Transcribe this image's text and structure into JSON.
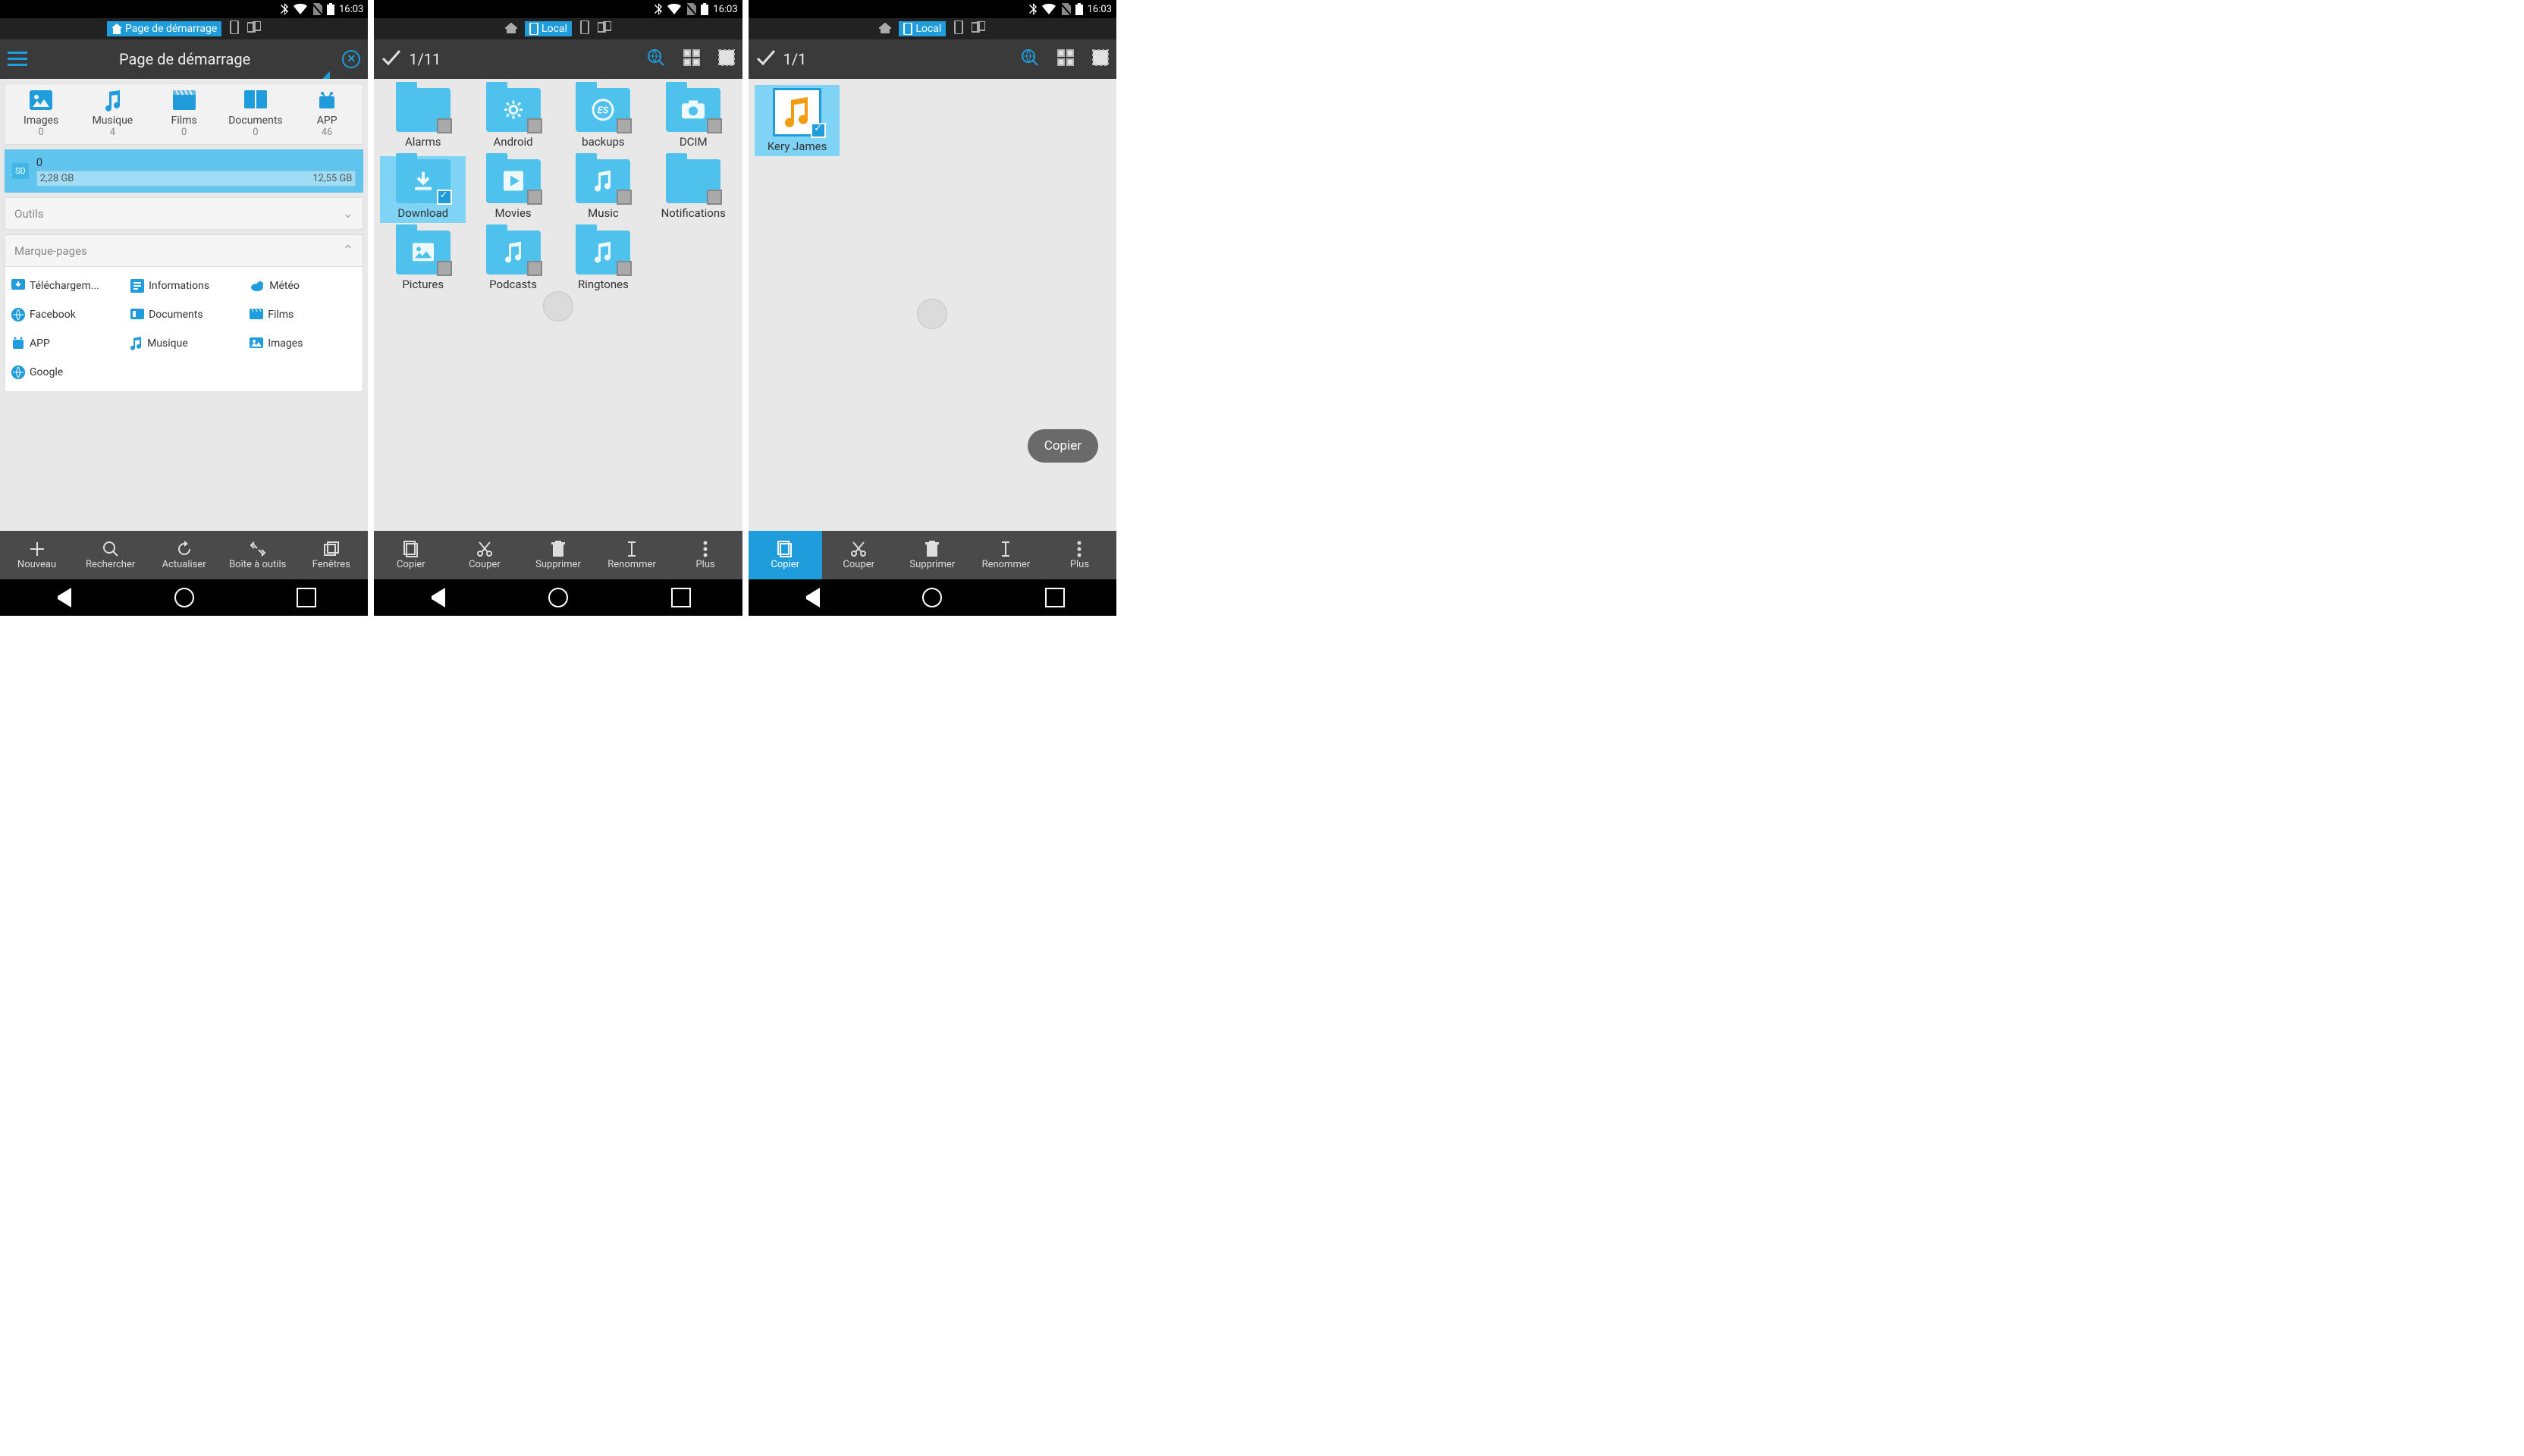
{
  "status": {
    "time": "16:03"
  },
  "screen1": {
    "tab_label": "Page de démarrage",
    "title": "Page de démarrage",
    "categories": [
      {
        "label": "Images",
        "count": "0"
      },
      {
        "label": "Musique",
        "count": "4"
      },
      {
        "label": "Films",
        "count": "0"
      },
      {
        "label": "Documents",
        "count": "0"
      },
      {
        "label": "APP",
        "count": "46"
      }
    ],
    "storage": {
      "name": "0",
      "used": "2,28 GB",
      "total": "12,55 GB"
    },
    "tools_label": "Outils",
    "bookmarks_label": "Marque-pages",
    "bookmarks": [
      {
        "label": "Téléchargem..."
      },
      {
        "label": "Informations"
      },
      {
        "label": "Météo"
      },
      {
        "label": "Facebook"
      },
      {
        "label": "Documents"
      },
      {
        "label": "Films"
      },
      {
        "label": "APP"
      },
      {
        "label": "Musique"
      },
      {
        "label": "Images"
      },
      {
        "label": "Google"
      }
    ],
    "bottom": [
      {
        "label": "Nouveau"
      },
      {
        "label": "Rechercher"
      },
      {
        "label": "Actualiser"
      },
      {
        "label": "Boîte à outils"
      },
      {
        "label": "Fenêtres"
      }
    ]
  },
  "screen2": {
    "tab_label": "Local",
    "count": "1/11",
    "folders": [
      {
        "label": "Alarms",
        "selected": false,
        "icon": "none"
      },
      {
        "label": "Android",
        "selected": false,
        "icon": "gear"
      },
      {
        "label": "backups",
        "selected": false,
        "icon": "es"
      },
      {
        "label": "DCIM",
        "selected": false,
        "icon": "camera"
      },
      {
        "label": "Download",
        "selected": true,
        "icon": "download"
      },
      {
        "label": "Movies",
        "selected": false,
        "icon": "play"
      },
      {
        "label": "Music",
        "selected": false,
        "icon": "music"
      },
      {
        "label": "Notifications",
        "selected": false,
        "icon": "none"
      },
      {
        "label": "Pictures",
        "selected": false,
        "icon": "picture"
      },
      {
        "label": "Podcasts",
        "selected": false,
        "icon": "music"
      },
      {
        "label": "Ringtones",
        "selected": false,
        "icon": "music"
      }
    ],
    "bottom": [
      {
        "label": "Copier"
      },
      {
        "label": "Couper"
      },
      {
        "label": "Supprimer"
      },
      {
        "label": "Renommer"
      },
      {
        "label": "Plus"
      }
    ]
  },
  "screen3": {
    "tab_label": "Local",
    "count": "1/1",
    "files": [
      {
        "label": "Kery James",
        "selected": true
      }
    ],
    "toast": "Copier",
    "bottom": [
      {
        "label": "Copier",
        "active": true
      },
      {
        "label": "Couper"
      },
      {
        "label": "Supprimer"
      },
      {
        "label": "Renommer"
      },
      {
        "label": "Plus"
      }
    ]
  }
}
